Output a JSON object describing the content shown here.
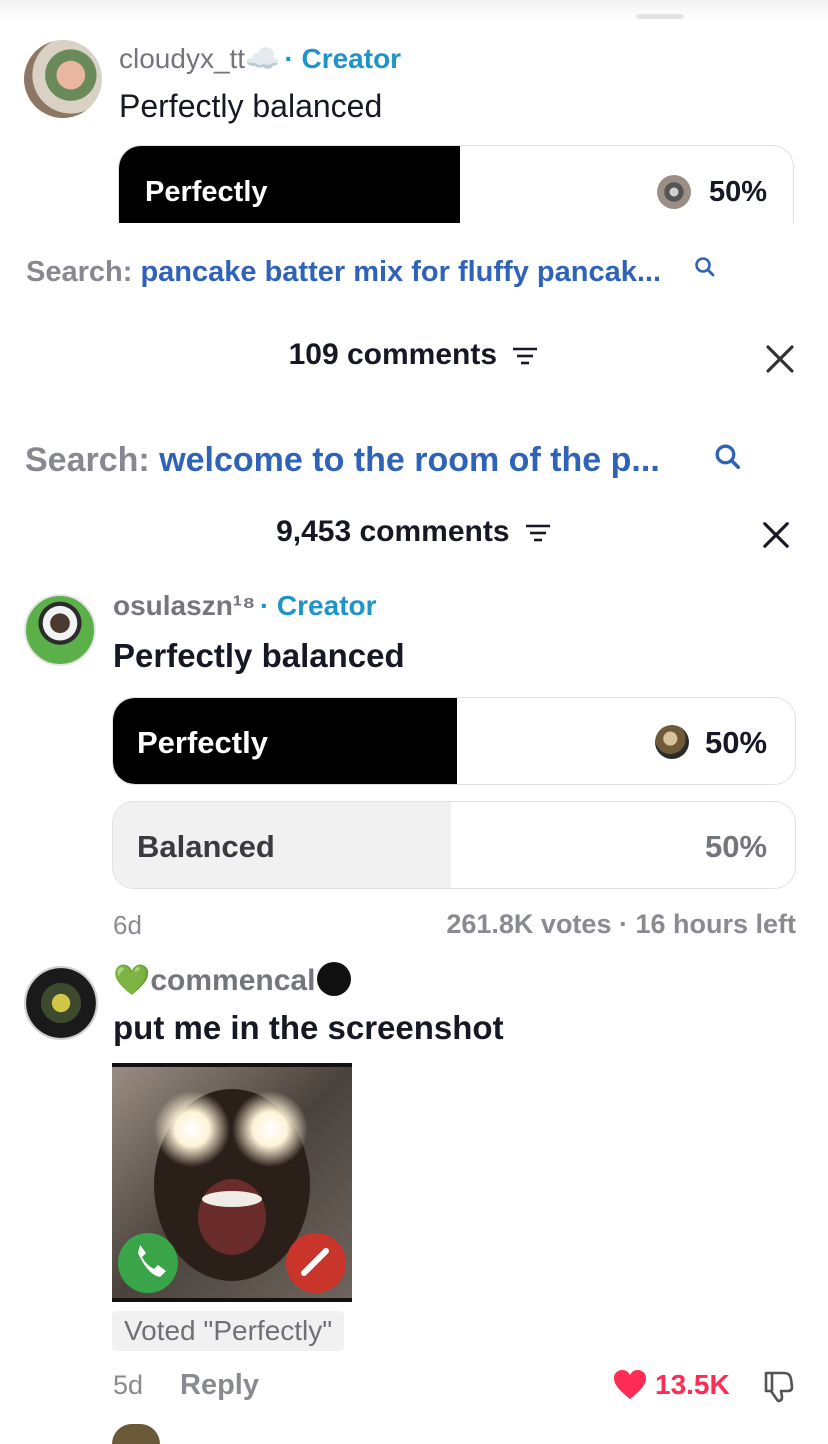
{
  "comment_top": {
    "username": "cloudyx_tt☁️",
    "creator_label": "· Creator",
    "text": "Perfectly balanced",
    "poll": [
      {
        "label": "Perfectly",
        "percent": "50%",
        "fill": 0.5
      }
    ]
  },
  "search_1": {
    "prefix": "Search:",
    "query": "pancake batter mix for fluffy pancak..."
  },
  "panel_1": {
    "comments_count": "109 comments"
  },
  "search_2": {
    "prefix": "Search:",
    "query": "welcome to the room of the p..."
  },
  "panel_2": {
    "comments_count": "9,453 comments"
  },
  "comment_poll": {
    "username": "osulaszn¹⁸",
    "creator_label": "· Creator",
    "text": "Perfectly balanced",
    "poll": [
      {
        "label": "Perfectly",
        "percent": "50%",
        "fill": 0.5
      },
      {
        "label": "Balanced",
        "percent": "50%",
        "fill": 0.5
      }
    ],
    "age": "6d",
    "votes": "261.8K votes · 16 hours left"
  },
  "comment_reply": {
    "username_prefix": "💚",
    "username": "commencal",
    "text": "put me in the screenshot",
    "voted": "Voted \"Perfectly\"",
    "age": "5d",
    "reply_label": "Reply",
    "likes": "13.5K"
  },
  "colors": {
    "accent_blue": "#1e94c9",
    "search_blue": "#2f63b8",
    "like_red": "#fe2c55"
  },
  "icons": [
    "search-icon",
    "sort-icon",
    "close-icon",
    "heart-icon",
    "dislike-icon",
    "accept-call-icon",
    "decline-call-icon"
  ]
}
